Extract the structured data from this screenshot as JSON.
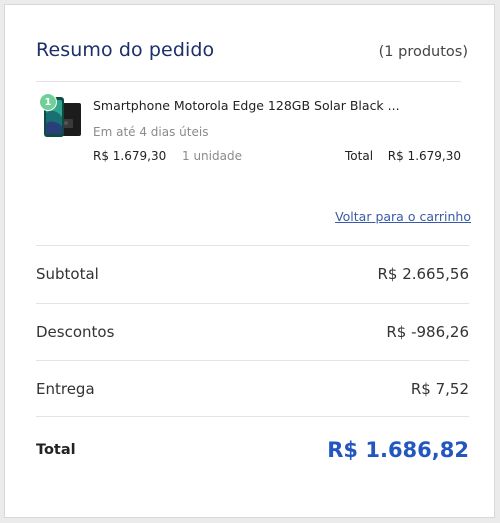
{
  "header": {
    "title": "Resumo do pedido",
    "count": "(1 produtos)"
  },
  "product": {
    "badge": "1",
    "image_icon": "smartphone-icon",
    "name": "Smartphone Motorola Edge 128GB Solar Black ...",
    "delivery": "Em até 4 dias úteis",
    "unit_price": "R$ 1.679,30",
    "quantity": "1 unidade",
    "total_label": "Total",
    "total_value": "R$ 1.679,30"
  },
  "back_link": "Voltar para o carrinho",
  "summary": {
    "subtotal_label": "Subtotal",
    "subtotal_value": "R$ 2.665,56",
    "discount_label": "Descontos",
    "discount_value": "R$ -986,26",
    "delivery_label": "Entrega",
    "delivery_value": "R$ 7,52",
    "total_label": "Total",
    "total_value": "R$ 1.686,82"
  },
  "colors": {
    "title": "#1d2f6b",
    "link": "#3b5aa8",
    "total": "#2456c0",
    "badge": "#6fcf97"
  }
}
